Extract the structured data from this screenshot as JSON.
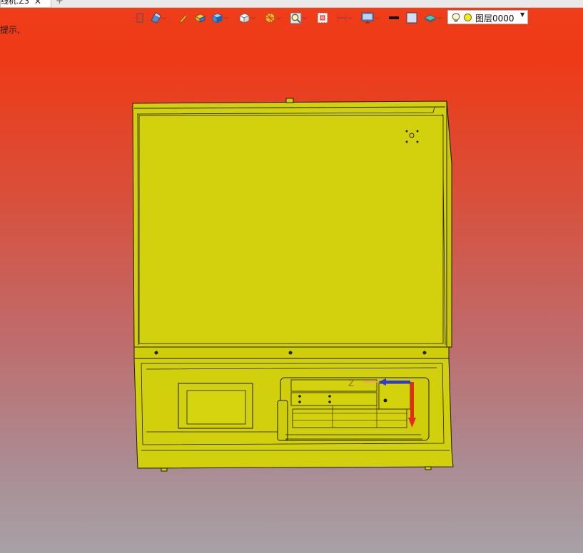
{
  "tabs": [
    {
      "label": "线机.Z3",
      "close_icon": "close-icon"
    }
  ],
  "add_tab_icon": "plus-icon",
  "hint_text": "提示,",
  "toolbar": {
    "items": [
      {
        "name": "exit-sketch-icon",
        "dropdown": false
      },
      {
        "name": "pen-sketch-icon",
        "dropdown": true
      },
      {
        "name": "pencil-icon",
        "dropdown": false
      },
      {
        "name": "colored-block-icon",
        "dropdown": false
      },
      {
        "name": "shaded-cube-icon",
        "dropdown": true
      },
      {
        "name": "white-cube-icon",
        "dropdown": true
      },
      {
        "name": "section-wheel-icon",
        "dropdown": true
      },
      {
        "name": "zoom-fit-icon",
        "dropdown": true
      },
      {
        "name": "zoom-window-icon",
        "dropdown": false
      },
      {
        "name": "dimension-icon",
        "dropdown": true
      },
      {
        "name": "display-monitor-icon",
        "dropdown": true
      },
      {
        "name": "line-style-icon",
        "dropdown": false
      },
      {
        "name": "color-swatch-icon",
        "dropdown": false
      },
      {
        "name": "layer-plane-icon",
        "dropdown": true
      }
    ]
  },
  "layer_selector": {
    "bulb_icon": "lightbulb-icon",
    "layer_name": "图层0000",
    "color": "#f2ec1a"
  },
  "model": {
    "body_color": "#d2d00c",
    "edge_color": "#1d1d10"
  },
  "triad": {
    "x_axis_color": "#2f3bd8",
    "z_axis_color": "#e62a1a",
    "z_label": "Z"
  },
  "colors": {
    "bg_top": "#f03d1a",
    "bg_bottom": "#a7a1a6"
  }
}
